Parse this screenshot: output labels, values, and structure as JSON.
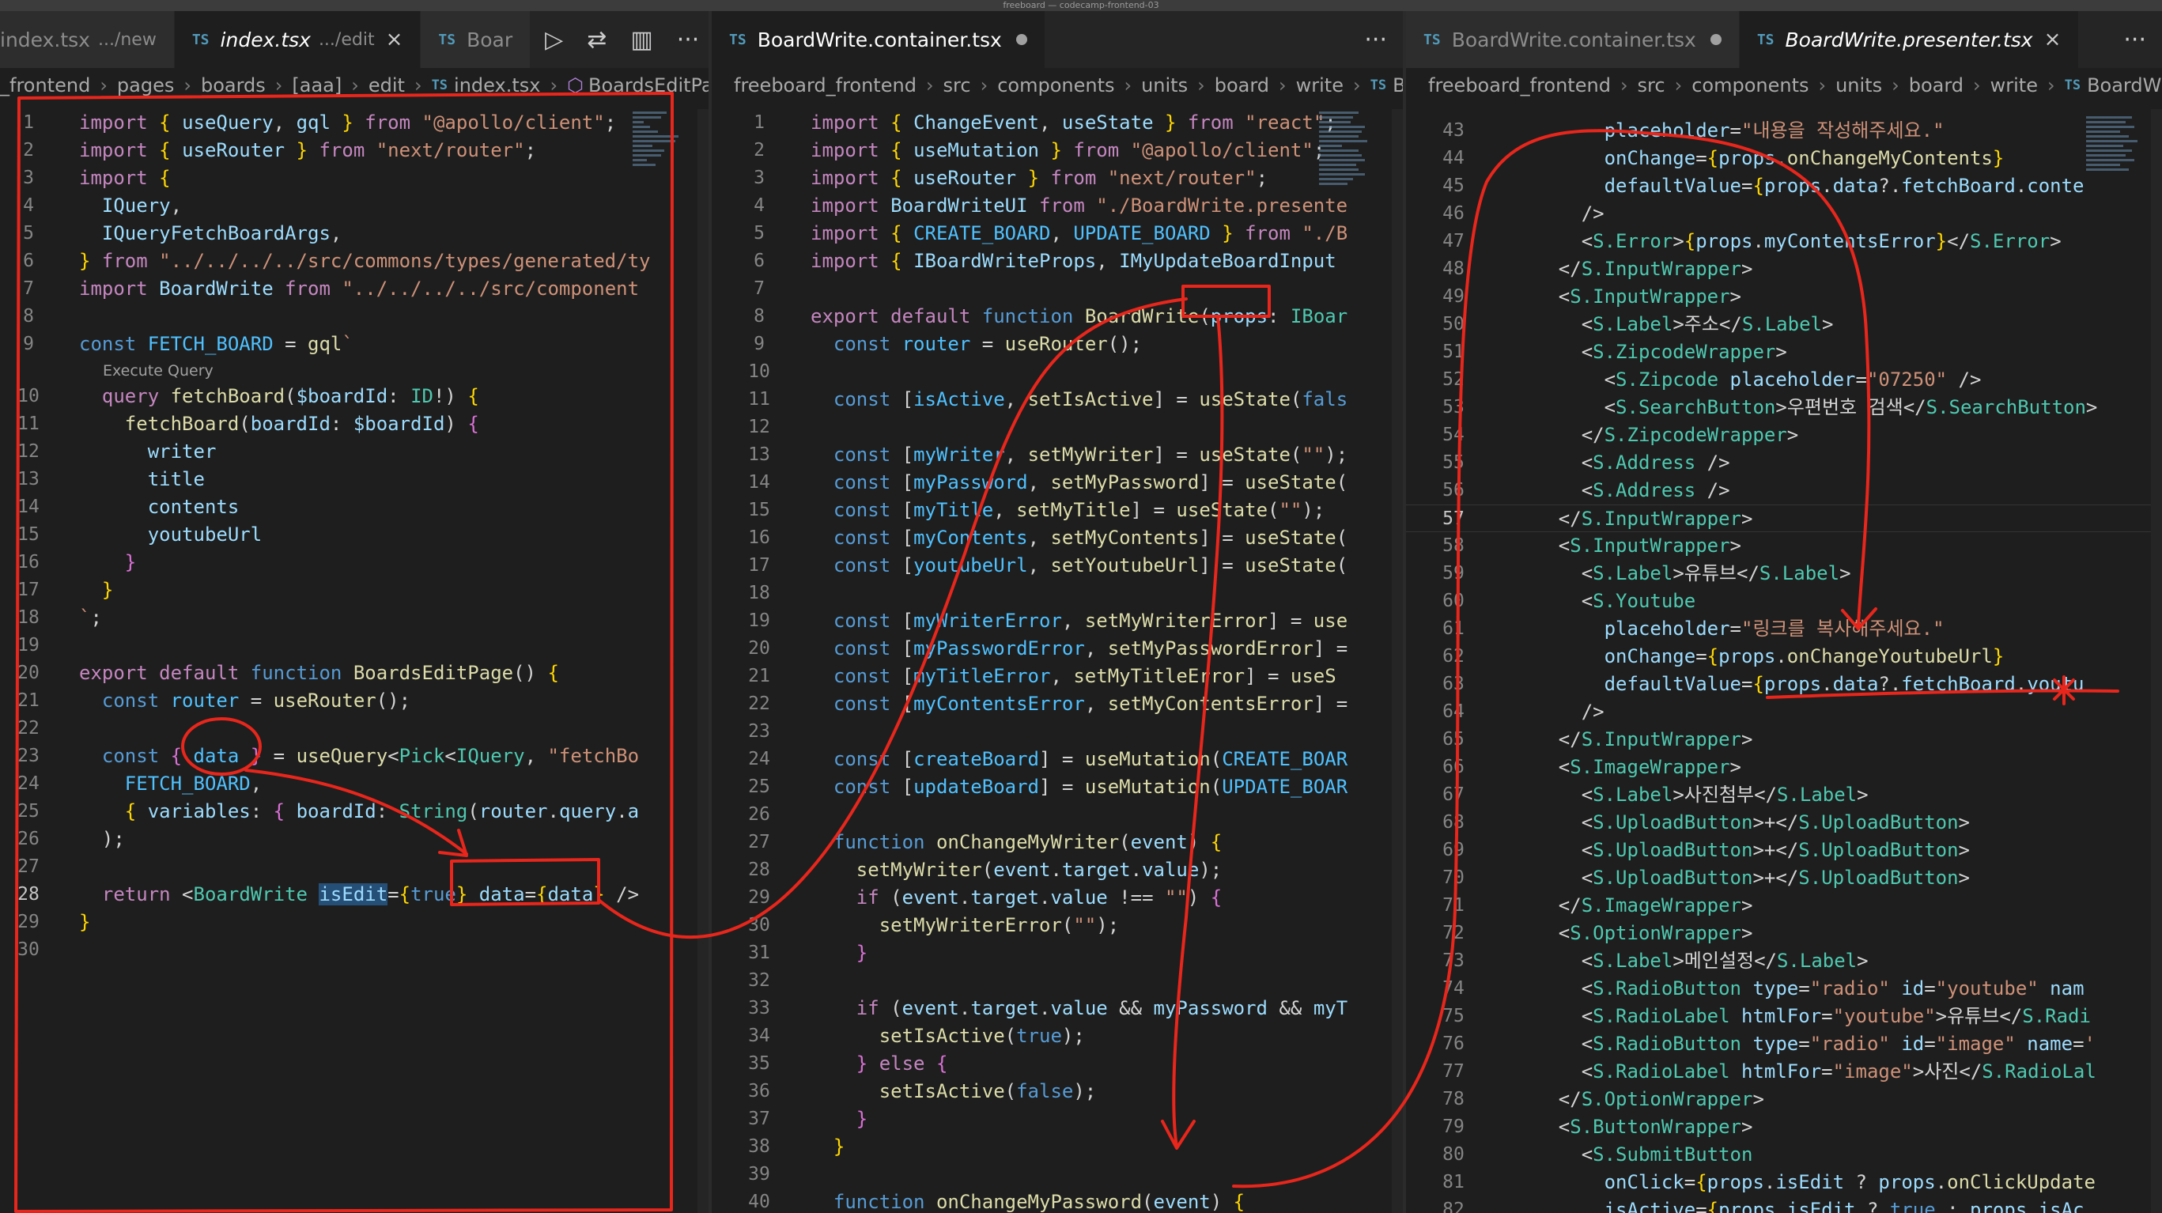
{
  "window": {
    "title": "freeboard — codecamp-frontend-03"
  },
  "pane1": {
    "tabs": [
      {
        "file": "index.tsx",
        "desc": ".../new"
      },
      {
        "file": "index.tsx",
        "desc": ".../edit"
      },
      {
        "file": "Boar"
      }
    ],
    "ts_badge": "TS",
    "close_glyph": "×",
    "actions": [
      "▷",
      "⇄",
      "▥",
      "···"
    ],
    "breadcrumb": [
      "_frontend",
      "pages",
      "boards",
      "[aaa]",
      "edit",
      "index.tsx",
      "BoardsEditPage"
    ],
    "codelens": "Execute Query",
    "line_numbers": [
      "1",
      "2",
      "3",
      "4",
      "5",
      "6",
      "7",
      "8",
      "9",
      "10",
      "11",
      "12",
      "13",
      "14",
      "15",
      "16",
      "17",
      "18",
      "19",
      "20",
      "21",
      "22",
      "23",
      "24",
      "25",
      "26",
      "27",
      "28",
      "29",
      "30"
    ],
    "current_line": "28"
  },
  "pane2": {
    "tabs": [
      {
        "file": "BoardWrite.container.tsx"
      }
    ],
    "actions": [
      "···"
    ],
    "breadcrumb": [
      "freeboard_frontend",
      "src",
      "components",
      "units",
      "board",
      "write",
      "Board"
    ],
    "line_numbers": [
      "1",
      "2",
      "3",
      "4",
      "5",
      "6",
      "7",
      "8",
      "9",
      "10",
      "11",
      "12",
      "13",
      "14",
      "15",
      "16",
      "17",
      "18",
      "19",
      "20",
      "21",
      "22",
      "23",
      "24",
      "25",
      "26",
      "27",
      "28",
      "29",
      "30",
      "31",
      "32",
      "33",
      "34",
      "35",
      "36",
      "37",
      "38",
      "39",
      "40"
    ]
  },
  "pane3": {
    "tabs": [
      {
        "file": "BoardWrite.container.tsx"
      },
      {
        "file": "BoardWrite.presenter.tsx"
      }
    ],
    "actions": [
      "···"
    ],
    "breadcrumb": [
      "freeboard_frontend",
      "src",
      "components",
      "units",
      "board",
      "write",
      "BoardWrite.pr"
    ],
    "line_numbers": [
      "43",
      "44",
      "45",
      "46",
      "47",
      "48",
      "49",
      "50",
      "51",
      "52",
      "53",
      "54",
      "55",
      "56",
      "57",
      "58",
      "59",
      "60",
      "61",
      "62",
      "63",
      "64",
      "65",
      "66",
      "67",
      "68",
      "69",
      "70",
      "71",
      "72",
      "73",
      "74",
      "75",
      "76",
      "77",
      "78",
      "79",
      "80",
      "81",
      "82"
    ],
    "current_line": "57"
  },
  "annotation_color": "#e8261c"
}
